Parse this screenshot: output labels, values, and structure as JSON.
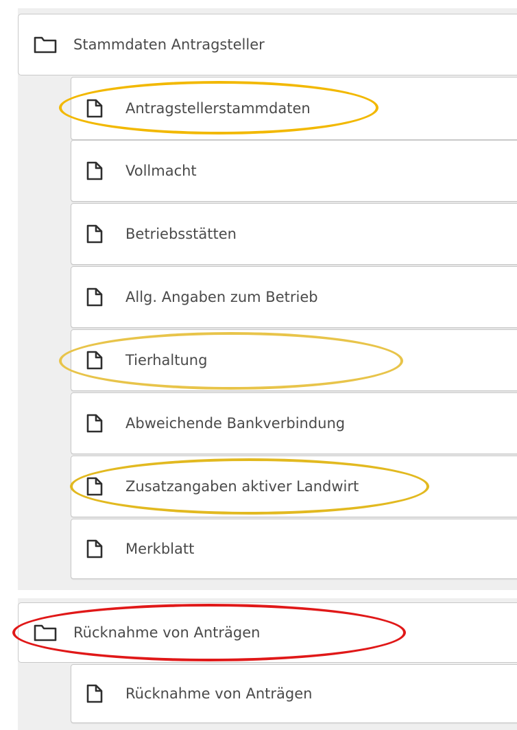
{
  "folders": [
    {
      "label": "Stammdaten Antragsteller",
      "icon": "folder-icon",
      "items": [
        {
          "label": "Antragstellerstammdaten",
          "icon": "document-icon"
        },
        {
          "label": "Vollmacht",
          "icon": "document-icon"
        },
        {
          "label": "Betriebsstätten",
          "icon": "document-icon"
        },
        {
          "label": "Allg. Angaben zum Betrieb",
          "icon": "document-icon"
        },
        {
          "label": "Tierhaltung",
          "icon": "document-icon"
        },
        {
          "label": "Abweichende Bankverbindung",
          "icon": "document-icon"
        },
        {
          "label": "Zusatzangaben aktiver Landwirt",
          "icon": "document-icon"
        },
        {
          "label": "Merkblatt",
          "icon": "document-icon"
        }
      ]
    },
    {
      "label": "Rücknahme von Anträgen",
      "icon": "folder-icon",
      "items": [
        {
          "label": "Rücknahme von Anträgen",
          "icon": "document-icon"
        }
      ]
    }
  ],
  "colors": {
    "text": "#4a4a4a",
    "border": "#c8c8c8",
    "group_background": "#efefef",
    "highlight_yellow": "#f2b800",
    "highlight_yellow_light": "#e8c44a",
    "highlight_red": "#e01818"
  }
}
